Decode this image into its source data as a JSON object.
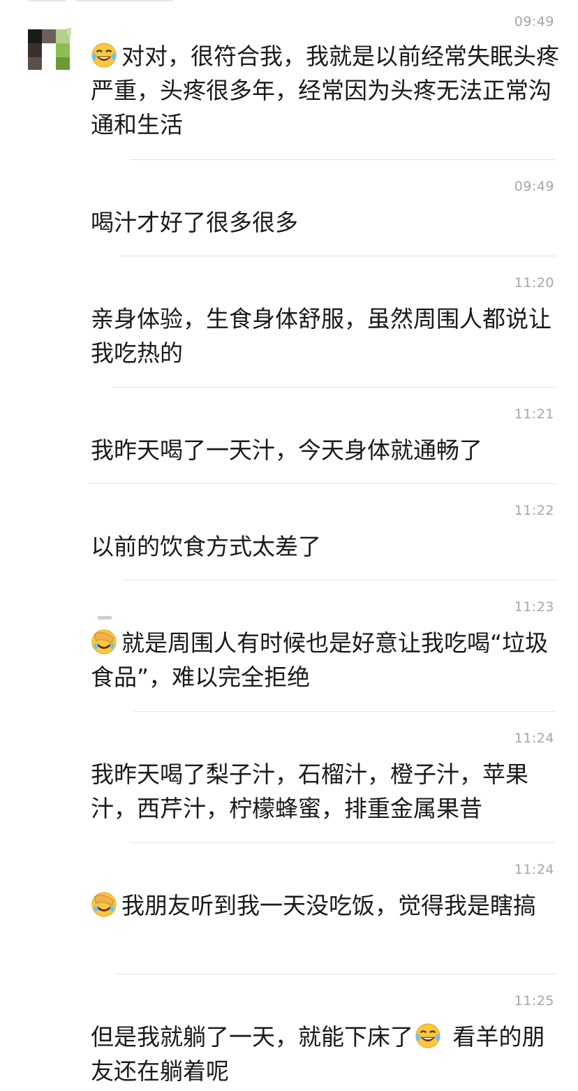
{
  "messages": [
    {
      "time": "09:49",
      "emoji": "laugh-tears",
      "text": "对对，很符合我，我就是以前经常失眠头疼严重，头疼很多年，经常因为头疼无法正常沟通和生活"
    },
    {
      "time": "09:49",
      "emoji": null,
      "text": "喝汁才好了很多很多"
    },
    {
      "time": "11:20",
      "emoji": null,
      "text": "亲身体验，生食身体舒服，虽然周围人都说让我吃热的"
    },
    {
      "time": "11:21",
      "emoji": null,
      "text": "我昨天喝了一天汁，今天身体就通畅了"
    },
    {
      "time": "11:22",
      "emoji": null,
      "text": "以前的饮食方式太差了"
    },
    {
      "time": "11:23",
      "emoji": "facepalm",
      "text": "就是周围人有时候也是好意让我吃喝“垃圾食品”，难以完全拒绝"
    },
    {
      "time": "11:24",
      "emoji": null,
      "text": "我昨天喝了梨子汁，石榴汁，橙子汁，苹果汁，西芹汁，柠檬蜂蜜，排重金属果昔"
    },
    {
      "time": "11:24",
      "emoji": "facepalm",
      "text": "我朋友听到我一天没吃饭，觉得我是瞎搞"
    },
    {
      "time": "11:25",
      "emoji": null,
      "text_before": "但是我就躺了一天，就能下床了",
      "inline_emoji": "laugh-tears",
      "text_after": " 看羊的朋友还在躺着呢"
    }
  ]
}
